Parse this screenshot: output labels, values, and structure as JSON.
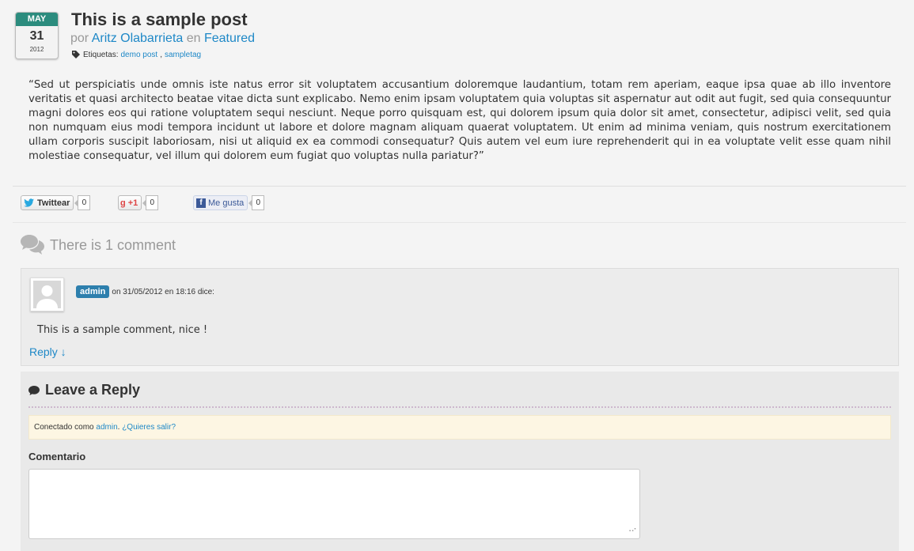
{
  "post": {
    "date": {
      "month": "MAY",
      "day": "31",
      "year": "2012"
    },
    "title": "This is a sample post",
    "meta": {
      "by": "por",
      "author": "Aritz Olabarrieta",
      "in": "en",
      "category": "Featured"
    },
    "tags": {
      "label": "Etiquetas:",
      "items": [
        "demo post",
        "sampletag"
      ],
      "separator": ","
    },
    "body": "“Sed ut perspiciatis unde omnis iste natus error sit voluptatem accusantium doloremque laudantium, totam rem aperiam, eaque ipsa quae ab illo inventore veritatis et quasi architecto beatae vitae dicta sunt explicabo. Nemo enim ipsam voluptatem quia voluptas sit aspernatur aut odit aut fugit, sed quia consequuntur magni dolores eos qui ratione voluptatem sequi nesciunt. Neque porro quisquam est, qui dolorem ipsum quia dolor sit amet, consectetur, adipisci velit, sed quia non numquam eius modi tempora incidunt ut labore et dolore magnam aliquam quaerat voluptatem. Ut enim ad minima veniam, quis nostrum exercitationem ullam corporis suscipit laboriosam, nisi ut aliquid ex ea commodi consequatur? Quis autem vel eum iure reprehenderit qui in ea voluptate velit esse quam nihil molestiae consequatur, vel illum qui dolorem eum fugiat quo voluptas nulla pariatur?”"
  },
  "social": {
    "twitter": {
      "label": "Twittear",
      "count": "0",
      "icon": "twitter-bird-icon"
    },
    "gplus": {
      "label": "+1",
      "count": "0",
      "icon": "google-plus-icon"
    },
    "facebook": {
      "label": "Me gusta",
      "count": "0",
      "icon": "facebook-icon"
    }
  },
  "comments": {
    "heading": "There is 1 comment",
    "items": [
      {
        "author": "admin",
        "meta": "on 31/05/2012 en 18:16 dice:",
        "text": "This is a sample comment, nice !",
        "reply": "Reply ↓"
      }
    ]
  },
  "reply_form": {
    "title": "Leave a Reply",
    "logged_in_prefix": "Conectado como",
    "user": "admin",
    "logout": "¿Quieres salir?",
    "comment_label": "Comentario",
    "comment_value": ""
  },
  "colors": {
    "accent": "#1e88c7",
    "badge": "#2c8c7e",
    "author": "#2d7fad"
  }
}
